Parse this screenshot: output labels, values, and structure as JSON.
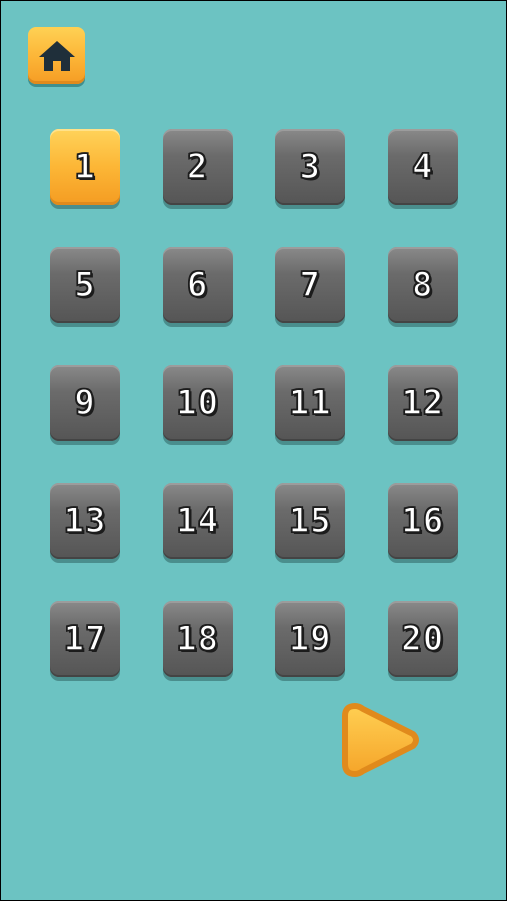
{
  "header": {
    "home_icon": "home-icon"
  },
  "levels": [
    "1",
    "2",
    "3",
    "4",
    "5",
    "6",
    "7",
    "8",
    "9",
    "10",
    "11",
    "12",
    "13",
    "14",
    "15",
    "16",
    "17",
    "18",
    "19",
    "20"
  ],
  "selected_level": "1",
  "footer": {
    "next_icon": "play-arrow-icon"
  },
  "colors": {
    "background": "#6cc3c2",
    "accent": "#fcb436",
    "tile": "#6b6b6b",
    "home_icon": "#1f2f3a"
  }
}
